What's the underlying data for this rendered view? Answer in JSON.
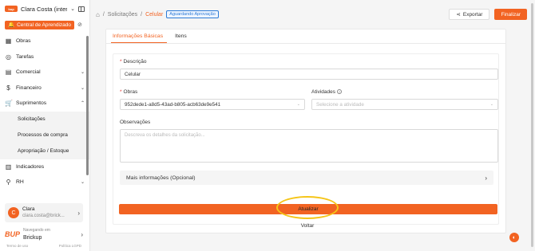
{
  "sidebar": {
    "company": "Clara Costa (inter...",
    "learning_center": "Central de Aprendizado",
    "items": [
      {
        "label": "Obras",
        "icon": "building-icon"
      },
      {
        "label": "Tarefas",
        "icon": "check-circle-icon"
      },
      {
        "label": "Comercial",
        "icon": "store-icon"
      },
      {
        "label": "Financeiro",
        "icon": "dollar-icon"
      },
      {
        "label": "Suprimentos",
        "icon": "cart-icon"
      }
    ],
    "sub_items": [
      "Solicitações",
      "Processos de compra",
      "Apropriação / Estoque"
    ],
    "more_items": [
      {
        "label": "Indicadores",
        "icon": "bar-chart-icon"
      },
      {
        "label": "RH",
        "icon": "person-icon"
      }
    ],
    "user": {
      "name": "Clara",
      "email": "clara.costa@brick...",
      "initial": "C"
    },
    "brand": {
      "browsing_label": "Navegando em",
      "name": "Brickup",
      "logo": "BUP"
    },
    "footer": {
      "terms": "Termo de uso",
      "privacy": "Política LGPD"
    }
  },
  "header": {
    "breadcrumb": [
      "Solicitações",
      "Celular"
    ],
    "status": "Aguardando Aprovação",
    "export_label": "Exportar",
    "finalize_label": "Finalizar"
  },
  "tabs": [
    {
      "label": "Informações Básicas",
      "active": true
    },
    {
      "label": "Itens",
      "active": false
    }
  ],
  "form": {
    "description_label": "Descrição",
    "description_value": "Celular",
    "obras_label": "Obras",
    "obras_value": "952dede1-a8d5-43ad-b805-acb63de9e541",
    "activities_label": "Atividades",
    "activities_placeholder": "Selecione a atividade",
    "notes_label": "Observações",
    "notes_placeholder": "Descreva os detalhes da solicitação...",
    "more_info_label": "Mais informações (Opcional)"
  },
  "actions": {
    "update_label": "Atualizar",
    "back_label": "Voltar"
  },
  "colors": {
    "accent": "#f26322",
    "status_blue": "#2e7bd6",
    "highlight": "#f5c518"
  }
}
